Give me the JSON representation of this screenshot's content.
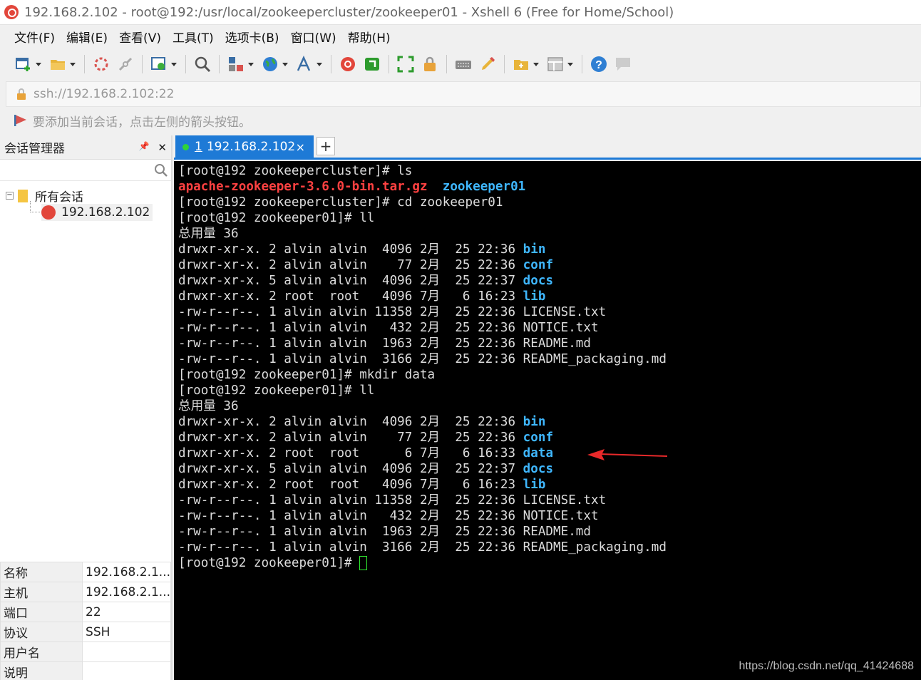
{
  "window": {
    "title": "192.168.2.102 - root@192:/usr/local/zookeepercluster/zookeeper01 - Xshell 6 (Free for Home/School)"
  },
  "menu": [
    "文件(F)",
    "编辑(E)",
    "查看(V)",
    "工具(T)",
    "选项卡(B)",
    "窗口(W)",
    "帮助(H)"
  ],
  "address": {
    "value": "ssh://192.168.2.102:22",
    "hint": "要添加当前会话，点击左侧的箭头按钮。"
  },
  "session_manager": {
    "title": "会话管理器",
    "pin": "📌",
    "close": "✕",
    "root_label": "所有会话",
    "session_label": "192.168.2.102"
  },
  "properties": [
    {
      "key": "名称",
      "value": "192.168.2.1..."
    },
    {
      "key": "主机",
      "value": "192.168.2.1..."
    },
    {
      "key": "端口",
      "value": "22"
    },
    {
      "key": "协议",
      "value": "SSH"
    },
    {
      "key": "用户名",
      "value": ""
    },
    {
      "key": "说明",
      "value": ""
    }
  ],
  "tab": {
    "number": "1",
    "label": "192.168.2.102",
    "close": "×",
    "add": "+"
  },
  "terminal": {
    "lines": [
      [
        {
          "t": "[root@192 zookeepercluster]# ls"
        }
      ],
      [
        {
          "t": "apache-zookeeper-3.6.0-bin.tar.gz",
          "c": "red"
        },
        {
          "t": "  "
        },
        {
          "t": "zookeeper01",
          "c": "blue"
        }
      ],
      [
        {
          "t": "[root@192 zookeepercluster]# cd zookeeper01"
        }
      ],
      [
        {
          "t": "[root@192 zookeeper01]# ll"
        }
      ],
      [
        {
          "t": "总用量 36"
        }
      ],
      [
        {
          "t": "drwxr-xr-x. 2 alvin alvin  4096 2月  25 22:36 "
        },
        {
          "t": "bin",
          "c": "blue"
        }
      ],
      [
        {
          "t": "drwxr-xr-x. 2 alvin alvin    77 2月  25 22:36 "
        },
        {
          "t": "conf",
          "c": "blue"
        }
      ],
      [
        {
          "t": "drwxr-xr-x. 5 alvin alvin  4096 2月  25 22:37 "
        },
        {
          "t": "docs",
          "c": "blue"
        }
      ],
      [
        {
          "t": "drwxr-xr-x. 2 root  root   4096 7月   6 16:23 "
        },
        {
          "t": "lib",
          "c": "blue"
        }
      ],
      [
        {
          "t": "-rw-r--r--. 1 alvin alvin 11358 2月  25 22:36 LICENSE.txt"
        }
      ],
      [
        {
          "t": "-rw-r--r--. 1 alvin alvin   432 2月  25 22:36 NOTICE.txt"
        }
      ],
      [
        {
          "t": "-rw-r--r--. 1 alvin alvin  1963 2月  25 22:36 README.md"
        }
      ],
      [
        {
          "t": "-rw-r--r--. 1 alvin alvin  3166 2月  25 22:36 README_packaging.md"
        }
      ],
      [
        {
          "t": "[root@192 zookeeper01]# mkdir data"
        }
      ],
      [
        {
          "t": "[root@192 zookeeper01]# ll"
        }
      ],
      [
        {
          "t": "总用量 36"
        }
      ],
      [
        {
          "t": "drwxr-xr-x. 2 alvin alvin  4096 2月  25 22:36 "
        },
        {
          "t": "bin",
          "c": "blue"
        }
      ],
      [
        {
          "t": "drwxr-xr-x. 2 alvin alvin    77 2月  25 22:36 "
        },
        {
          "t": "conf",
          "c": "blue"
        }
      ],
      [
        {
          "t": "drwxr-xr-x. 2 root  root      6 7月   6 16:33 "
        },
        {
          "t": "data",
          "c": "blue"
        }
      ],
      [
        {
          "t": "drwxr-xr-x. 5 alvin alvin  4096 2月  25 22:37 "
        },
        {
          "t": "docs",
          "c": "blue"
        }
      ],
      [
        {
          "t": "drwxr-xr-x. 2 root  root   4096 7月   6 16:23 "
        },
        {
          "t": "lib",
          "c": "blue"
        }
      ],
      [
        {
          "t": "-rw-r--r--. 1 alvin alvin 11358 2月  25 22:36 LICENSE.txt"
        }
      ],
      [
        {
          "t": "-rw-r--r--. 1 alvin alvin   432 2月  25 22:36 NOTICE.txt"
        }
      ],
      [
        {
          "t": "-rw-r--r--. 1 alvin alvin  1963 2月  25 22:36 README.md"
        }
      ],
      [
        {
          "t": "-rw-r--r--. 1 alvin alvin  3166 2月  25 22:36 README_packaging.md"
        }
      ],
      [
        {
          "t": "[root@192 zookeeper01]# "
        }
      ]
    ]
  },
  "watermark": "https://blog.csdn.net/qq_41424688",
  "colors": {
    "accent": "#1e7ad6",
    "terminal_bg": "#000000",
    "dir": "#3fb7ff",
    "archive": "#ff4141",
    "cursor": "#2fe32f"
  },
  "toolbar_icons": [
    "new-session-icon",
    "open-folder-icon",
    "reconnect-icon",
    "disconnect-icon",
    "properties-icon",
    "find-icon",
    "transfer-icon",
    "globe-icon",
    "font-icon",
    "xshell-icon",
    "xftp-icon",
    "fullscreen-icon",
    "lock-icon",
    "keyboard-icon",
    "highlight-icon",
    "new-folder-icon",
    "layout-icon",
    "help-icon",
    "chat-icon"
  ]
}
